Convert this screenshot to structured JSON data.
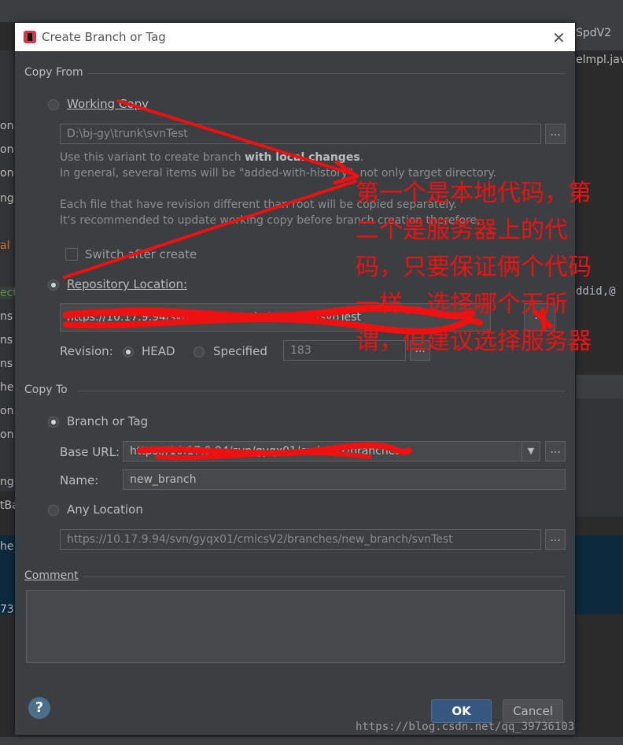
{
  "ide": {
    "branch_combo": "SpdV2",
    "file_tab": "elmpl.java",
    "right_code": "ddid,@",
    "left_fragments": [
      "on",
      "on",
      "on",
      "ng",
      "al",
      "ect",
      "ns",
      "ns",
      "ns",
      "he",
      "on",
      "on",
      "ng",
      "tBa",
      "he",
      "73"
    ]
  },
  "dialog": {
    "title": "Create Branch or Tag",
    "icon": "intellij-icon",
    "close_icon": "close-icon",
    "copy_from": {
      "section_label": "Copy From",
      "working_copy": {
        "label": "Working Copy",
        "path": "D:\\bj-gy\\trunk\\svnTest",
        "help_line1_prefix": "Use this variant to create branch ",
        "help_line1_bold": "with local changes",
        "help_line1_suffix": ".",
        "help_line2": "In general, several items will be \"added-with-history\", not only target directory.",
        "help_line3": "Each file that have revision different than root will be copied separately.",
        "help_line4": "It's recommended to update working copy before branch creation therefore.",
        "switch_after_create": "Switch after create"
      },
      "repository_location": {
        "label": "Repository Location:",
        "url": "https://10.17.9.94/svn/gyqx01/cmicsV2/trunk/svnTest",
        "revision_label": "Revision:",
        "head_label": "HEAD",
        "specified_label": "Specified",
        "specified_value": "183"
      }
    },
    "copy_to": {
      "section_label": "Copy To",
      "branch_or_tag": "Branch or Tag",
      "base_url_label": "Base URL:",
      "base_url": "https://10.17.9.94/svn/gyqx01/cmicsV2/branches",
      "name_label": "Name:",
      "name_value": "new_branch",
      "any_location": "Any Location",
      "any_location_url": "https://10.17.9.94/svn/gyqx01/cmicsV2/branches/new_branch/svnTest"
    },
    "comment_label": "Comment",
    "help_glyph": "?",
    "ok_label": "OK",
    "cancel_label": "Cancel",
    "dots": "...",
    "combo_arrow": "▼"
  },
  "annotation": {
    "lines": [
      "第一个是本地代码，第",
      "二个是服务器上的代",
      "码，只要保证俩个代码",
      "一样，选择哪个无所",
      "谓，但建议选择服务器"
    ],
    "color": "#ee1111"
  },
  "watermark": "https://blog.csdn.net/qq_39736103"
}
